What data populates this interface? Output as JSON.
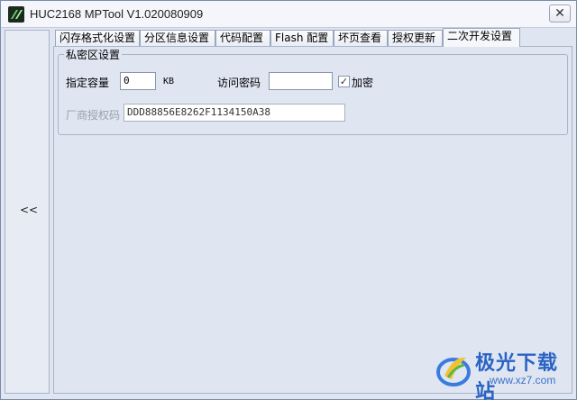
{
  "window": {
    "title": "HUC2168 MPTool V1.020080909",
    "close_label": "✕"
  },
  "left_panel": {
    "collapse_label": "<<"
  },
  "tabs": [
    {
      "label": "闪存格式化设置",
      "active": false
    },
    {
      "label": "分区信息设置",
      "active": false
    },
    {
      "label": "代码配置",
      "active": false
    },
    {
      "label": "Flash 配置",
      "active": false
    },
    {
      "label": "坏页查看",
      "active": false
    },
    {
      "label": "授权更新",
      "active": false
    },
    {
      "label": "二次开发设置",
      "active": true
    }
  ],
  "private_area": {
    "group_title": "私密区设置",
    "capacity_label": "指定容量",
    "capacity_value": "0",
    "capacity_unit": "KB",
    "password_label": "访问密码",
    "password_value": "",
    "encrypt_label": "加密",
    "encrypt_checked": true,
    "vendor_key_label": "厂商授权码",
    "vendor_key_value": "DDD88856E8262F1134150A38"
  },
  "watermark": {
    "text": "极光下载站",
    "url": "www.xz7.com"
  }
}
